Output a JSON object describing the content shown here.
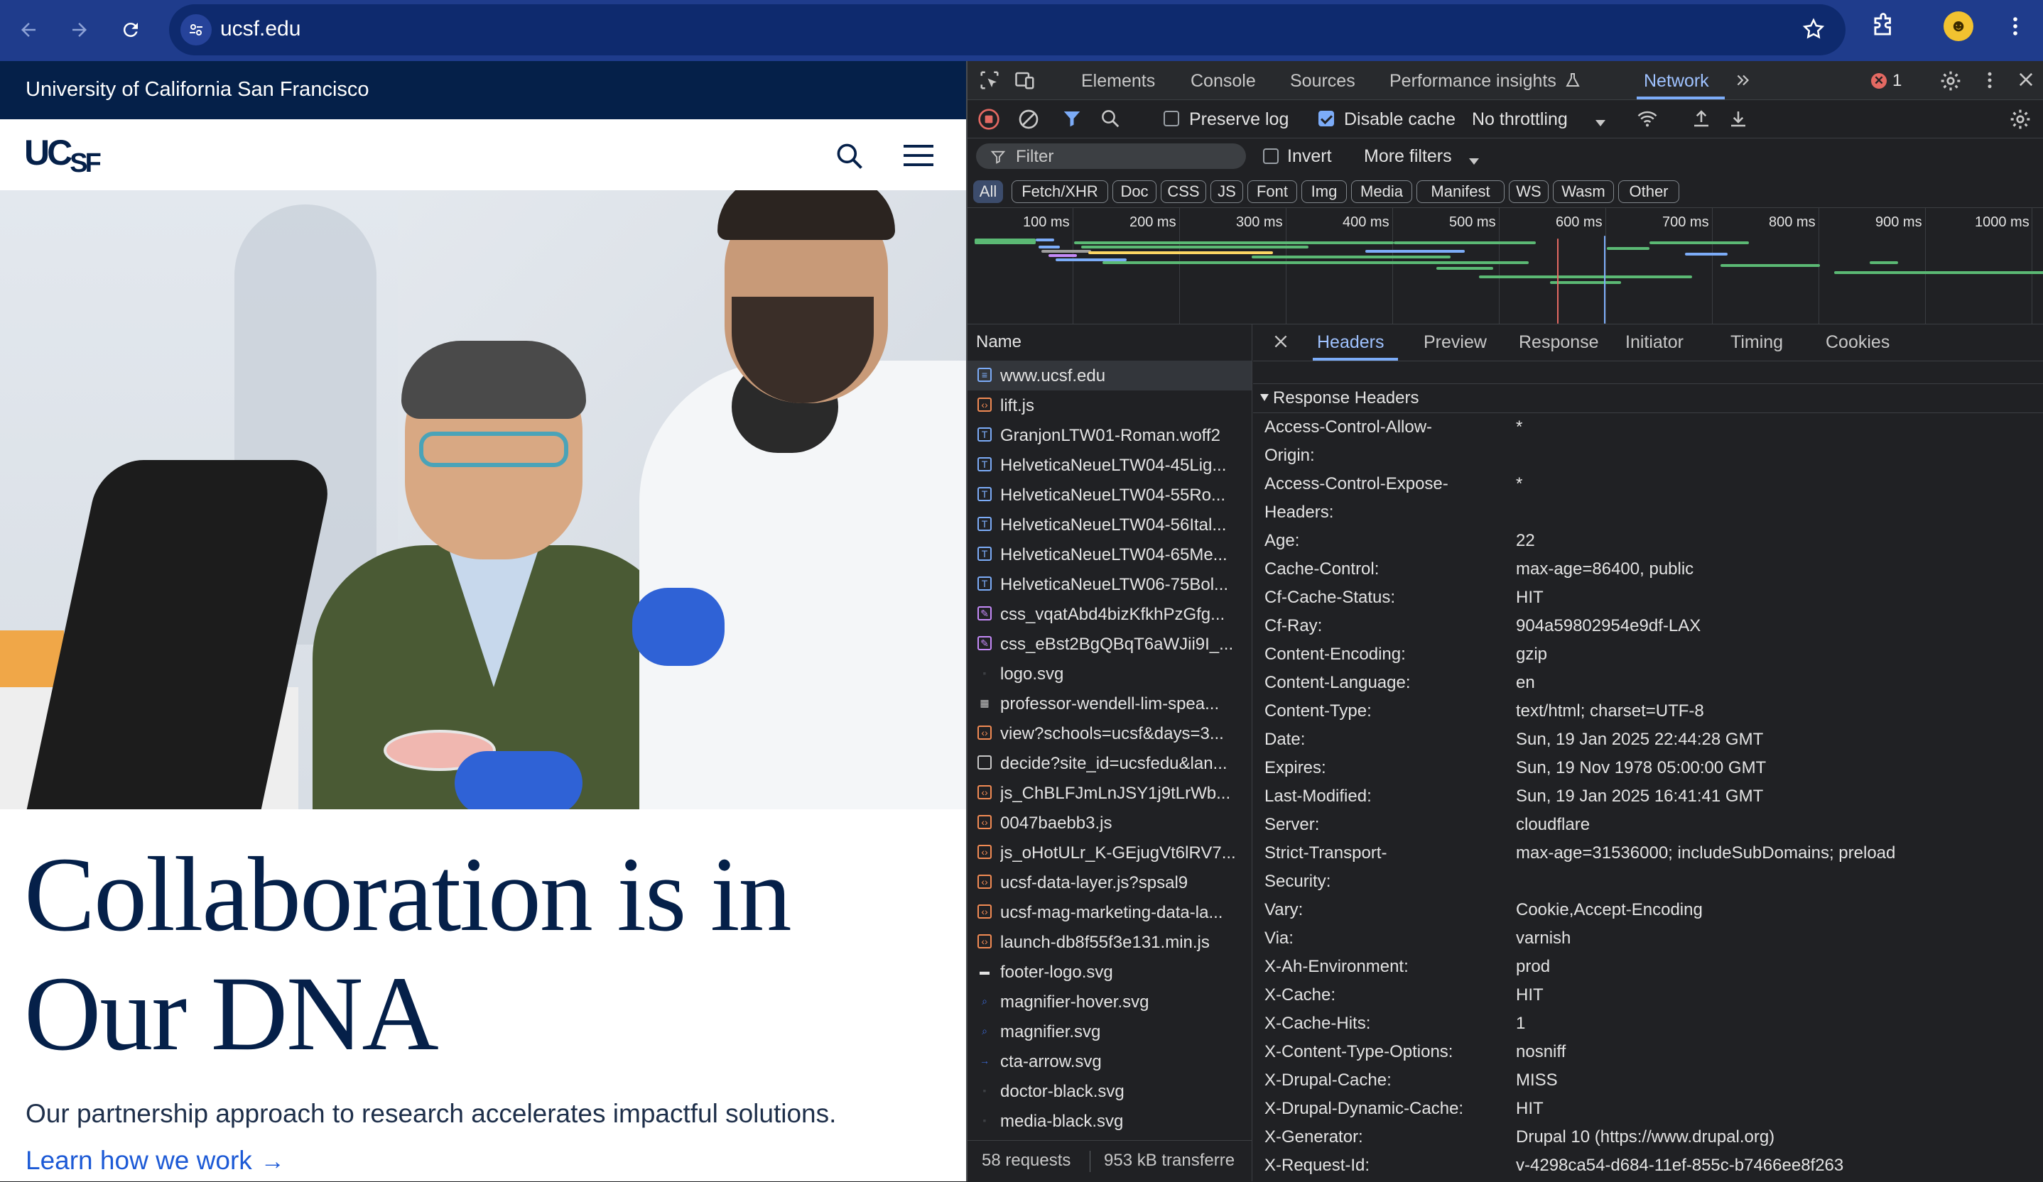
{
  "browser": {
    "url": "ucsf.edu",
    "colors": {
      "chrome": "#1f3c8c",
      "omnibox": "#0e2a6e"
    }
  },
  "site": {
    "top_bar": "University of California San Francisco",
    "logo": {
      "uc": "UC",
      "sf": "SF"
    },
    "hero_image_alt": "professor-wendell-lim-speaking",
    "headline": "Collaboration is in Our DNA",
    "tagline": "Our partnership approach to research accelerates impactful solutions.",
    "cta": "Learn how we work",
    "cta_arrow": "→",
    "colors": {
      "navy": "#052049",
      "link": "#1d5ad6"
    }
  },
  "devtools": {
    "tabs": [
      "Elements",
      "Console",
      "Sources",
      "Performance insights",
      "Network"
    ],
    "active_tab": "Network",
    "error_count": "1",
    "toolbar": {
      "preserve_log": "Preserve log",
      "preserve_log_checked": false,
      "disable_cache": "Disable cache",
      "disable_cache_checked": true,
      "throttling": "No throttling"
    },
    "filter": {
      "placeholder": "Filter",
      "invert": "Invert",
      "more_filters": "More filters"
    },
    "type_filters": [
      "All",
      "Fetch/XHR",
      "Doc",
      "CSS",
      "JS",
      "Font",
      "Img",
      "Media",
      "Manifest",
      "WS",
      "Wasm",
      "Other"
    ],
    "timeline_ticks": [
      "100 ms",
      "200 ms",
      "300 ms",
      "400 ms",
      "500 ms",
      "600 ms",
      "700 ms",
      "800 ms",
      "900 ms",
      "1000 ms"
    ],
    "name_header": "Name",
    "requests": [
      {
        "name": "www.ucsf.edu",
        "type": "doc"
      },
      {
        "name": "lift.js",
        "type": "js"
      },
      {
        "name": "GranjonLTW01-Roman.woff2",
        "type": "font"
      },
      {
        "name": "HelveticaNeueLTW04-45Lig...",
        "type": "font"
      },
      {
        "name": "HelveticaNeueLTW04-55Ro...",
        "type": "font"
      },
      {
        "name": "HelveticaNeueLTW04-56Ital...",
        "type": "font"
      },
      {
        "name": "HelveticaNeueLTW04-65Me...",
        "type": "font"
      },
      {
        "name": "HelveticaNeueLTW06-75Bol...",
        "type": "font"
      },
      {
        "name": "css_vqatAbd4bizKfkhPzGfg...",
        "type": "css"
      },
      {
        "name": "css_eBst2BgQBqT6aWJii9I_...",
        "type": "css"
      },
      {
        "name": "logo.svg",
        "type": "svg-dark"
      },
      {
        "name": "professor-wendell-lim-spea...",
        "type": "img"
      },
      {
        "name": "view?schools=ucsf&days=3...",
        "type": "js"
      },
      {
        "name": "decide?site_id=ucsfedu&lan...",
        "type": "other"
      },
      {
        "name": "js_ChBLFJmLnJSY1j9tLrWb...",
        "type": "js"
      },
      {
        "name": "0047baebb3.js",
        "type": "js"
      },
      {
        "name": "js_oHotULr_K-GEjugVt6lRV7...",
        "type": "js"
      },
      {
        "name": "ucsf-data-layer.js?spsal9",
        "type": "js"
      },
      {
        "name": "ucsf-mag-marketing-data-la...",
        "type": "js"
      },
      {
        "name": "launch-db8f55f3e131.min.js",
        "type": "js"
      },
      {
        "name": "footer-logo.svg",
        "type": "svg-white"
      },
      {
        "name": "magnifier-hover.svg",
        "type": "svg-search"
      },
      {
        "name": "magnifier.svg",
        "type": "svg-search"
      },
      {
        "name": "cta-arrow.svg",
        "type": "svg-arrow"
      },
      {
        "name": "doctor-black.svg",
        "type": "svg-dark"
      },
      {
        "name": "media-black.svg",
        "type": "svg-dark"
      }
    ],
    "status": {
      "requests": "58 requests",
      "transferred": "953 kB transferre"
    },
    "detail_tabs": [
      "Headers",
      "Preview",
      "Response",
      "Initiator",
      "Timing",
      "Cookies"
    ],
    "active_detail_tab": "Headers",
    "section_title": "Response Headers",
    "response_headers": [
      {
        "key": "Access-Control-Allow-Origin:",
        "value": "*"
      },
      {
        "key": "Access-Control-Expose-Headers:",
        "value": "*"
      },
      {
        "key": "Age:",
        "value": "22"
      },
      {
        "key": "Cache-Control:",
        "value": "max-age=86400, public"
      },
      {
        "key": "Cf-Cache-Status:",
        "value": "HIT"
      },
      {
        "key": "Cf-Ray:",
        "value": "904a59802954e9df-LAX"
      },
      {
        "key": "Content-Encoding:",
        "value": "gzip"
      },
      {
        "key": "Content-Language:",
        "value": "en"
      },
      {
        "key": "Content-Type:",
        "value": "text/html; charset=UTF-8"
      },
      {
        "key": "Date:",
        "value": "Sun, 19 Jan 2025 22:44:28 GMT"
      },
      {
        "key": "Expires:",
        "value": "Sun, 19 Nov 1978 05:00:00 GMT"
      },
      {
        "key": "Last-Modified:",
        "value": "Sun, 19 Jan 2025 16:41:41 GMT"
      },
      {
        "key": "Server:",
        "value": "cloudflare"
      },
      {
        "key": "Strict-Transport-Security:",
        "value": "max-age=31536000; includeSubDomains; preload"
      },
      {
        "key": "Vary:",
        "value": "Cookie,Accept-Encoding"
      },
      {
        "key": "Via:",
        "value": "varnish"
      },
      {
        "key": "X-Ah-Environment:",
        "value": "prod"
      },
      {
        "key": "X-Cache:",
        "value": "HIT"
      },
      {
        "key": "X-Cache-Hits:",
        "value": "1"
      },
      {
        "key": "X-Content-Type-Options:",
        "value": "nosniff"
      },
      {
        "key": "X-Drupal-Cache:",
        "value": "MISS"
      },
      {
        "key": "X-Drupal-Dynamic-Cache:",
        "value": "HIT"
      },
      {
        "key": "X-Generator:",
        "value": "Drupal 10 (https://www.drupal.org)"
      },
      {
        "key": "X-Request-Id:",
        "value": "v-4298ca54-d684-11ef-855c-b7466ee8f263"
      }
    ],
    "colors": {
      "accent": "#7cacf8",
      "background": "#202124",
      "error": "#e46962"
    }
  }
}
